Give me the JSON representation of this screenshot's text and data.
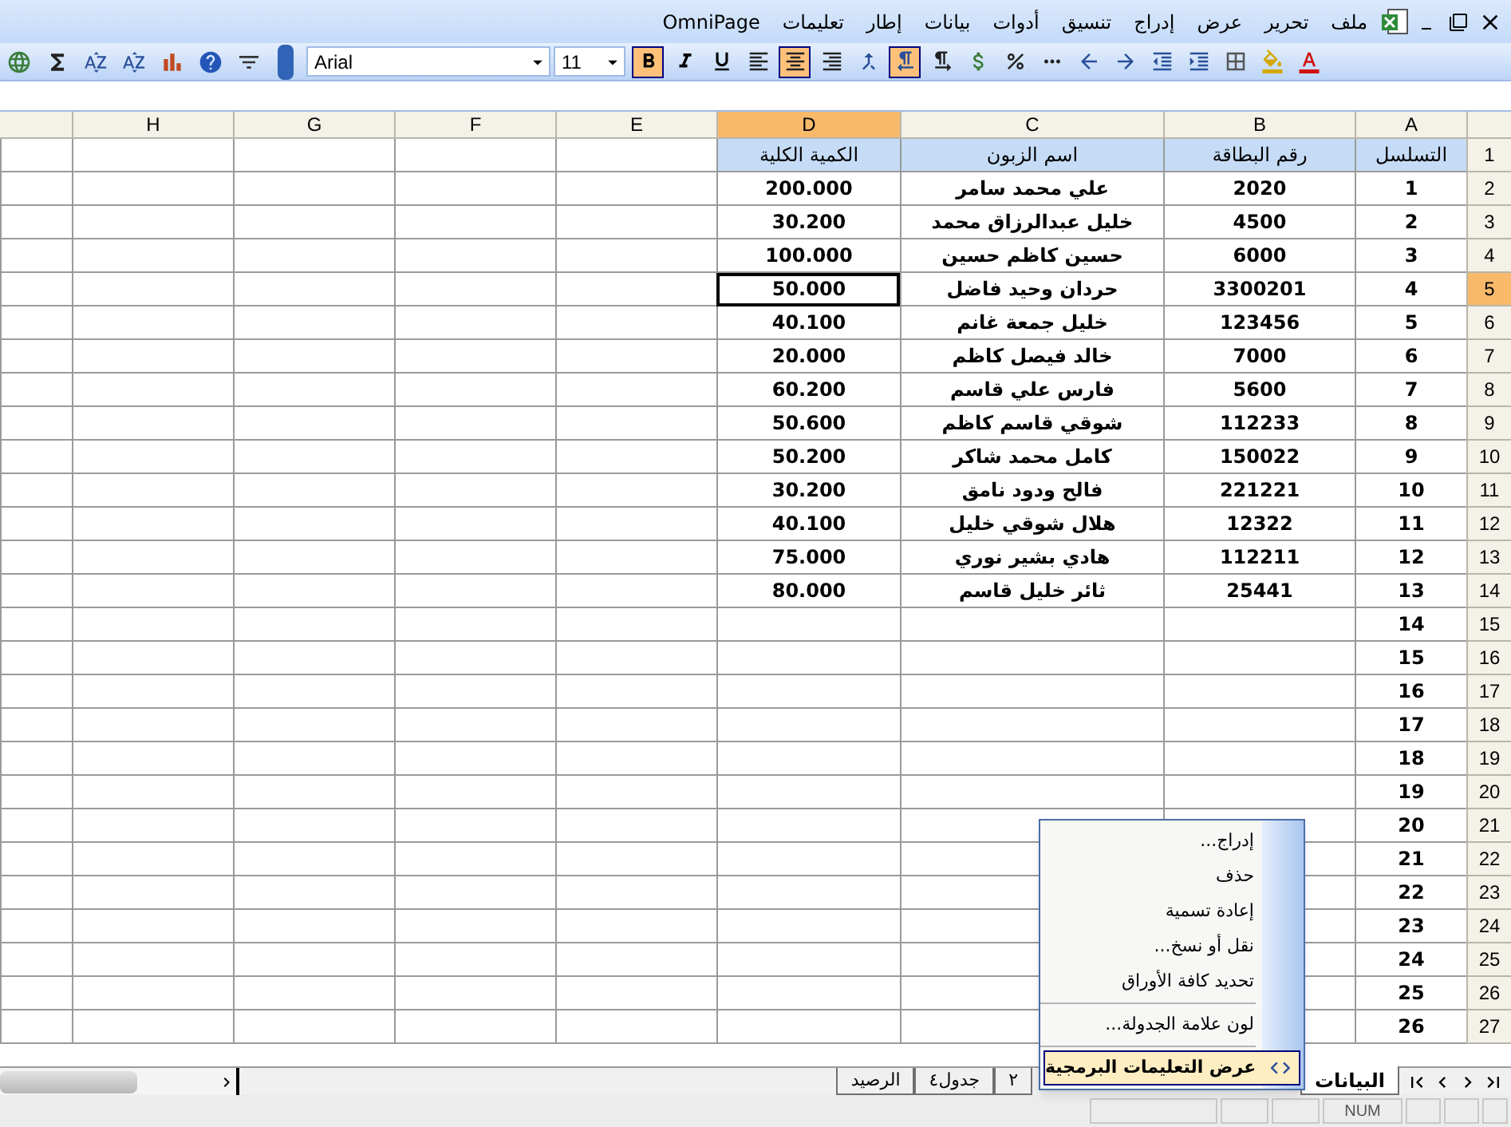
{
  "menu_bar": {
    "items": [
      "ملف",
      "تحرير",
      "عرض",
      "إدراج",
      "تنسيق",
      "أدوات",
      "بيانات",
      "إطار",
      "تعليمات",
      "OmniPage"
    ]
  },
  "toolbar": {
    "left_buttons": [
      {
        "kind": "research"
      },
      {
        "kind": "sum"
      },
      {
        "kind": "sort-asc"
      },
      {
        "kind": "sort-desc"
      },
      {
        "kind": "chart"
      },
      {
        "kind": "help"
      },
      {
        "kind": "filter"
      }
    ],
    "font": "Arial",
    "size": "11",
    "format_buttons": [
      {
        "kind": "bold",
        "selected": true
      },
      {
        "kind": "italic",
        "selected": false
      },
      {
        "kind": "underline",
        "selected": false
      },
      {
        "kind": "align-left",
        "selected": false
      },
      {
        "kind": "align-center",
        "selected": true
      },
      {
        "kind": "align-right",
        "selected": false
      },
      {
        "kind": "merge",
        "selected": false
      },
      {
        "kind": "rtl",
        "selected": true
      },
      {
        "kind": "ltr",
        "selected": false
      },
      {
        "kind": "currency",
        "selected": false
      },
      {
        "kind": "percent",
        "selected": false
      },
      {
        "kind": "comma",
        "selected": false
      },
      {
        "kind": "decimal-more",
        "selected": false
      },
      {
        "kind": "decimal-less",
        "selected": false
      },
      {
        "kind": "outdent",
        "selected": false
      },
      {
        "kind": "indent",
        "selected": false
      },
      {
        "kind": "borders",
        "selected": false
      },
      {
        "kind": "fill",
        "selected": false
      },
      {
        "kind": "font-color",
        "selected": false
      }
    ]
  },
  "columns": [
    {
      "label": "A",
      "selected": false
    },
    {
      "label": "B",
      "selected": false
    },
    {
      "label": "C",
      "selected": false
    },
    {
      "label": "D",
      "selected": true
    },
    {
      "label": "E",
      "selected": false
    },
    {
      "label": "F",
      "selected": false
    },
    {
      "label": "G",
      "selected": false
    },
    {
      "label": "H",
      "selected": false
    }
  ],
  "rows": [
    {
      "number": "1",
      "selected": false,
      "kind": "header",
      "cells": [
        "التسلسل",
        "رقم البطاقة",
        "اسم الزبون",
        "الكمية الكلية"
      ]
    },
    {
      "number": "2",
      "selected": false,
      "kind": "data",
      "cells": [
        "1",
        "2020",
        "علي محمد سامر",
        "200.000"
      ]
    },
    {
      "number": "3",
      "selected": false,
      "kind": "data",
      "cells": [
        "2",
        "4500",
        "خليل عبدالرزاق محمد",
        "30.200"
      ]
    },
    {
      "number": "4",
      "selected": false,
      "kind": "data",
      "cells": [
        "3",
        "6000",
        "حسين كاظم حسين",
        "100.000"
      ]
    },
    {
      "number": "5",
      "selected": true,
      "kind": "data",
      "cells": [
        "4",
        "3300201",
        "حردان وحيد فاضل",
        "50.000"
      ]
    },
    {
      "number": "6",
      "selected": false,
      "kind": "data",
      "cells": [
        "5",
        "123456",
        "خليل جمعة غانم",
        "40.100"
      ]
    },
    {
      "number": "7",
      "selected": false,
      "kind": "data",
      "cells": [
        "6",
        "7000",
        "خالد فيصل كاظم",
        "20.000"
      ]
    },
    {
      "number": "8",
      "selected": false,
      "kind": "data",
      "cells": [
        "7",
        "5600",
        "فارس علي قاسم",
        "60.200"
      ]
    },
    {
      "number": "9",
      "selected": false,
      "kind": "data",
      "cells": [
        "8",
        "112233",
        "شوقي قاسم كاظم",
        "50.600"
      ]
    },
    {
      "number": "10",
      "selected": false,
      "kind": "data",
      "cells": [
        "9",
        "150022",
        "كامل محمد شاكر",
        "50.200"
      ]
    },
    {
      "number": "11",
      "selected": false,
      "kind": "data",
      "cells": [
        "10",
        "221221",
        "فالح ودود نامق",
        "30.200"
      ]
    },
    {
      "number": "12",
      "selected": false,
      "kind": "data",
      "cells": [
        "11",
        "12322",
        "هلال شوقي خليل",
        "40.100"
      ]
    },
    {
      "number": "13",
      "selected": false,
      "kind": "data",
      "cells": [
        "12",
        "112211",
        "هادي بشير نوري",
        "75.000"
      ]
    },
    {
      "number": "14",
      "selected": false,
      "kind": "data",
      "cells": [
        "13",
        "25441",
        "ثائر خليل قاسم",
        "80.000"
      ]
    },
    {
      "number": "15",
      "selected": false,
      "kind": "data",
      "cells": [
        "14"
      ]
    },
    {
      "number": "16",
      "selected": false,
      "kind": "data",
      "cells": [
        "15"
      ]
    },
    {
      "number": "17",
      "selected": false,
      "kind": "data",
      "cells": [
        "16"
      ]
    },
    {
      "number": "18",
      "selected": false,
      "kind": "data",
      "cells": [
        "17"
      ]
    },
    {
      "number": "19",
      "selected": false,
      "kind": "data",
      "cells": [
        "18"
      ]
    },
    {
      "number": "20",
      "selected": false,
      "kind": "data",
      "cells": [
        "19"
      ]
    },
    {
      "number": "21",
      "selected": false,
      "kind": "data",
      "cells": [
        "20"
      ]
    },
    {
      "number": "22",
      "selected": false,
      "kind": "data",
      "cells": [
        "21"
      ]
    },
    {
      "number": "23",
      "selected": false,
      "kind": "data",
      "cells": [
        "22"
      ]
    },
    {
      "number": "24",
      "selected": false,
      "kind": "data",
      "cells": [
        "23"
      ]
    },
    {
      "number": "25",
      "selected": false,
      "kind": "data",
      "cells": [
        "24"
      ]
    },
    {
      "number": "26",
      "selected": false,
      "kind": "data",
      "cells": [
        "25"
      ]
    },
    {
      "number": "27",
      "selected": false,
      "kind": "data",
      "cells": [
        "26"
      ]
    }
  ],
  "context_menu": {
    "items": [
      {
        "kind": "item",
        "label": "إدراج...",
        "selected": false
      },
      {
        "kind": "item",
        "label": "حذف",
        "selected": false
      },
      {
        "kind": "item",
        "label": "إعادة تسمية",
        "selected": false
      },
      {
        "kind": "item",
        "label": "نقل أو نسخ...",
        "selected": false
      },
      {
        "kind": "item",
        "label": "تحديد كافة الأوراق",
        "selected": false
      },
      {
        "kind": "separator"
      },
      {
        "kind": "item",
        "label": "لون علامة الجدولة...",
        "selected": false
      },
      {
        "kind": "separator"
      },
      {
        "kind": "code",
        "label": "عرض التعليمات البرمجية",
        "selected": true
      }
    ]
  },
  "sheet_tabs": [
    {
      "label": "البيانات",
      "selected": true,
      "kind": "tab"
    },
    {
      "kind": "hidden"
    },
    {
      "label": "٢",
      "selected": false,
      "kind": "tab"
    },
    {
      "label": "جدول٤",
      "selected": false,
      "kind": "tab"
    },
    {
      "label": "الرصيد",
      "selected": false,
      "kind": "tab"
    }
  ],
  "status_bar": {
    "indicator": "NUM"
  }
}
